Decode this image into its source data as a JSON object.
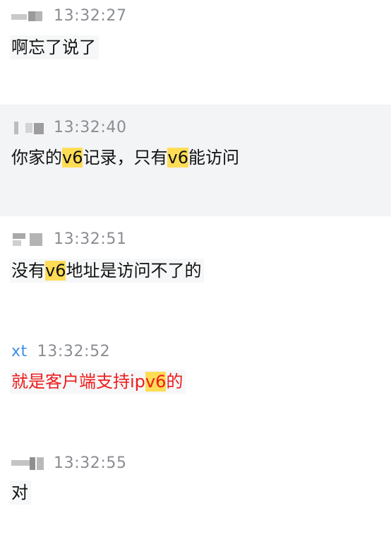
{
  "messages": [
    {
      "time": "13:32:27",
      "parts": [
        "啊忘了说了"
      ]
    },
    {
      "time": "13:32:40",
      "parts": [
        "你家的",
        "v6",
        "记录，只有",
        "v6",
        "能访问"
      ]
    },
    {
      "time": "13:32:51",
      "parts": [
        "没有",
        "v6",
        "地址是访问不了的"
      ]
    },
    {
      "sender": "xt",
      "time": "13:32:52",
      "parts": [
        "就是客户端支持ip",
        "v6",
        "的"
      ]
    },
    {
      "time": "13:32:55",
      "parts": [
        "对"
      ]
    }
  ],
  "colors": {
    "highlight": "#ffdc55",
    "sender_name": "#3d8ee8",
    "timestamp": "#8a8d92",
    "alert_text": "#ee1c1c",
    "shaded_row": "#f3f4f6"
  }
}
